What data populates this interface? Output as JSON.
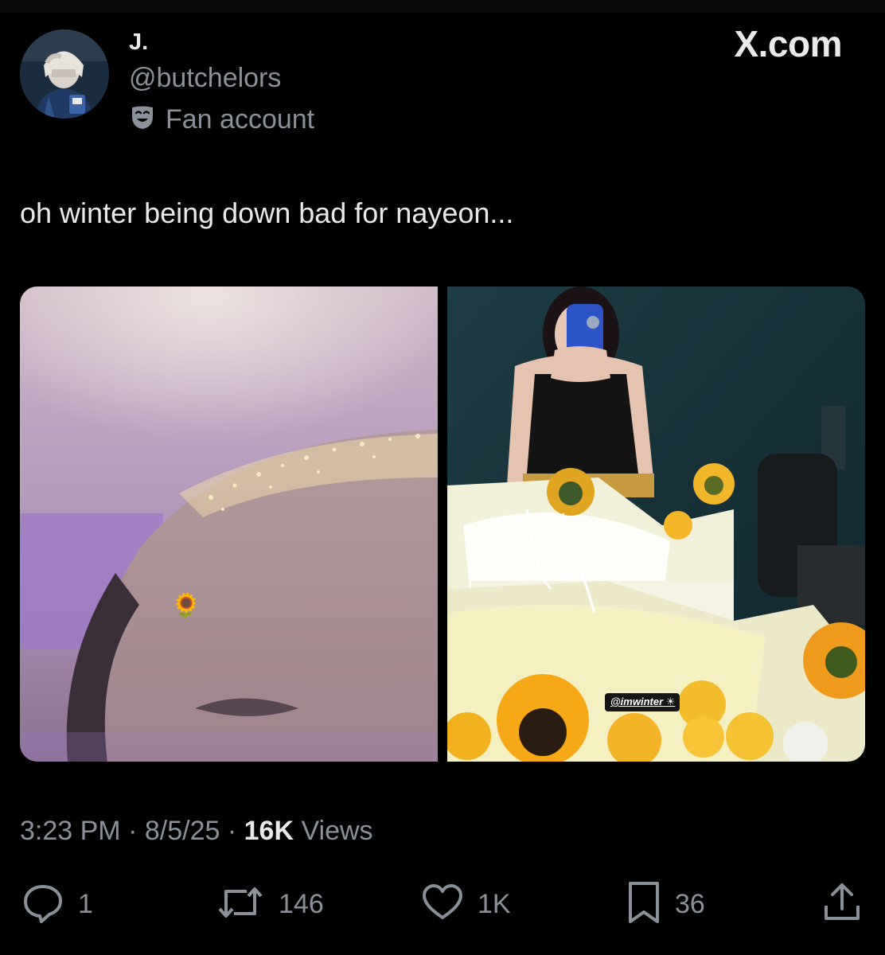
{
  "brand": {
    "label": "X.com"
  },
  "author": {
    "display_name": "J.",
    "handle": "@butchelors",
    "affiliation": "Fan account",
    "affiliation_icon": "theater-mask-icon"
  },
  "tweet": {
    "text": "oh winter being down bad for nayeon...",
    "time": "3:23 PM",
    "date": "8/5/25",
    "separator": "·",
    "views_count": "16K",
    "views_label": "Views"
  },
  "media": {
    "photo_left_sticker": "🌻",
    "photo_right_tag": "@imwinter"
  },
  "actions": {
    "reply": {
      "icon": "reply-icon",
      "count": "1"
    },
    "retweet": {
      "icon": "retweet-icon",
      "count": "146"
    },
    "like": {
      "icon": "heart-icon",
      "count": "1K"
    },
    "bookmark": {
      "icon": "bookmark-icon",
      "count": "36"
    },
    "share": {
      "icon": "share-icon"
    }
  },
  "colors": {
    "background": "#000000",
    "primary_text": "#e7e9ea",
    "secondary_text": "#8b9198"
  }
}
